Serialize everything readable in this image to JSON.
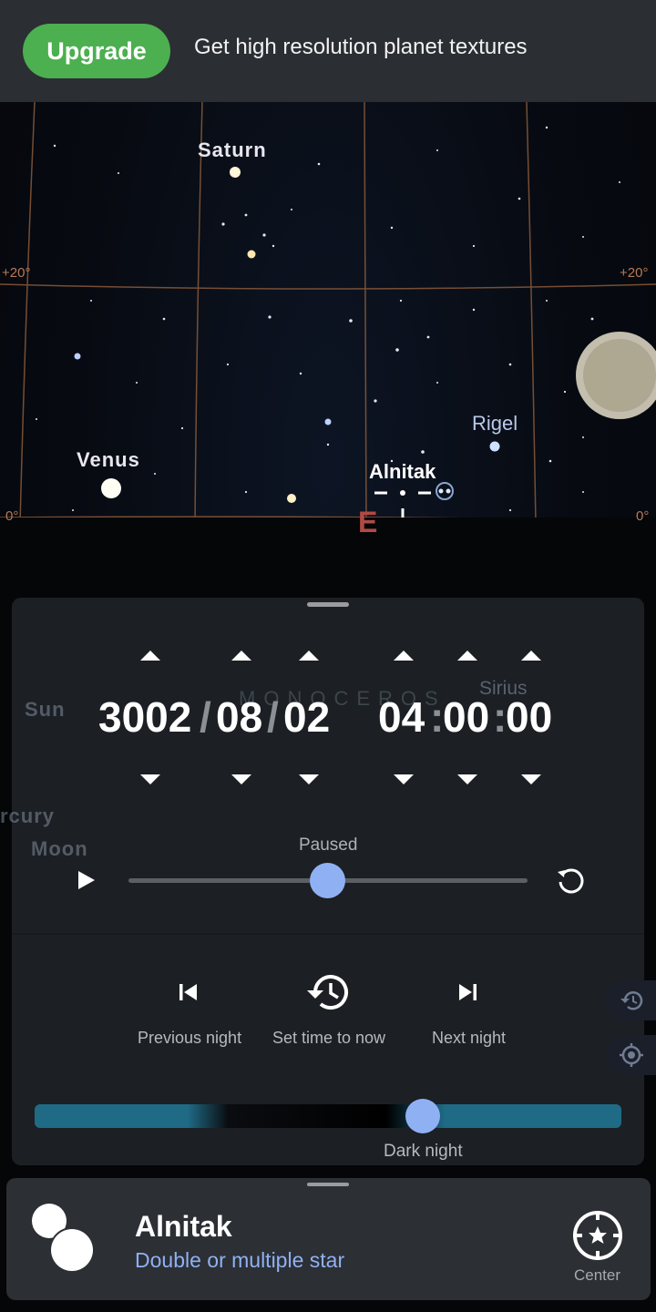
{
  "banner": {
    "upgrade_label": "Upgrade",
    "text": "Get high resolution planet textures"
  },
  "sky": {
    "labels": {
      "saturn": "Saturn",
      "venus": "Venus",
      "rigel": "Rigel",
      "alnitak": "Alnitak",
      "east": "E"
    },
    "grid": {
      "plus20_left": "+20°",
      "plus20_right": "+20°",
      "zero_left": "0°",
      "zero_right": "0°"
    },
    "ghost": {
      "sun": "Sun",
      "mercury": "rcury",
      "moon": "Moon",
      "monoceros": "MONOCEROS",
      "sirius": "Sirius"
    }
  },
  "time_panel": {
    "date": {
      "year": "3002",
      "month": "08",
      "day": "02",
      "sep": "/"
    },
    "time": {
      "hour": "04",
      "minute": "00",
      "second": "00",
      "sep": ":"
    },
    "status": "Paused",
    "speed_fraction": 0.5,
    "nav": {
      "previous": "Previous night",
      "now": "Set time to now",
      "next": "Next night"
    },
    "night_label": "Dark night",
    "night_fraction": 0.66
  },
  "info_card": {
    "name": "Alnitak",
    "type": "Double or multiple star",
    "center_label": "Center"
  },
  "icons": [
    "play-icon",
    "reset-icon",
    "skip-previous-icon",
    "history-icon",
    "skip-next-icon",
    "target-icon",
    "center-icon",
    "double-star-icon"
  ],
  "colors": {
    "accent": "#8fb1f4",
    "upgrade": "#4caf50",
    "grid": "#b87a55"
  }
}
